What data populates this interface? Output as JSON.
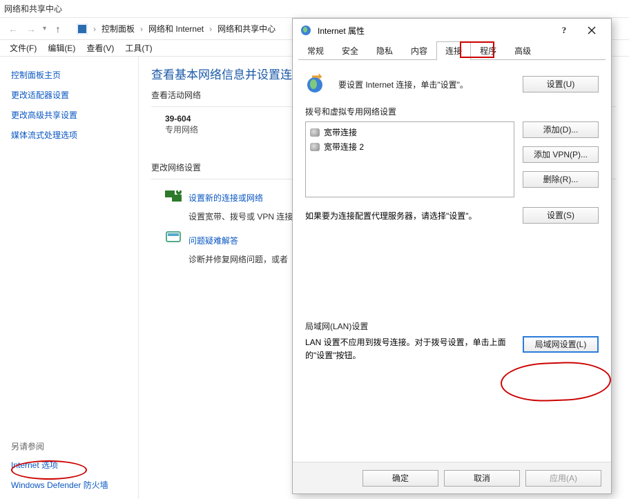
{
  "window": {
    "title": "网络和共享中心",
    "breadcrumb": [
      "控制面板",
      "网络和 Internet",
      "网络和共享中心"
    ],
    "menu": {
      "file": "文件(F)",
      "edit": "编辑(E)",
      "view": "查看(V)",
      "tools": "工具(T)"
    }
  },
  "sidebar": {
    "items": [
      "控制面板主页",
      "更改适配器设置",
      "更改高级共享设置",
      "媒体流式处理选项"
    ],
    "see_also_label": "另请参阅",
    "see_also": [
      "Internet 选项",
      "Windows Defender 防火墙"
    ]
  },
  "content": {
    "heading": "查看基本网络信息并设置连接",
    "active_label": "查看活动网络",
    "network": {
      "name": "39-604",
      "type": "专用网络"
    },
    "change_label": "更改网络设置",
    "new_conn": {
      "title": "设置新的连接或网络",
      "desc": "设置宽带、拨号或 VPN 连接"
    },
    "troubleshoot": {
      "title": "问题疑难解答",
      "desc": "诊断并修复网络问题，或者"
    }
  },
  "dialog": {
    "title": "Internet 属性",
    "tabs": [
      "常规",
      "安全",
      "隐私",
      "内容",
      "连接",
      "程序",
      "高级"
    ],
    "row1": {
      "text": "要设置 Internet 连接，单击\"设置\"。",
      "btn": "设置(U)"
    },
    "dial_group_label": "拨号和虚拟专用网络设置",
    "dial_items": [
      "宽带连接",
      "宽带连接 2"
    ],
    "btn_add": "添加(D)...",
    "btn_add_vpn": "添加 VPN(P)...",
    "btn_remove": "删除(R)...",
    "proxy_text": "如果要为连接配置代理服务器，请选择\"设置\"。",
    "btn_settings": "设置(S)",
    "lan_group_label": "局域网(LAN)设置",
    "lan_text": "LAN 设置不应用到拨号连接。对于拨号设置，单击上面的\"设置\"按钮。",
    "btn_lan": "局域网设置(L)",
    "footer": {
      "ok": "确定",
      "cancel": "取消",
      "apply": "应用(A)"
    }
  }
}
